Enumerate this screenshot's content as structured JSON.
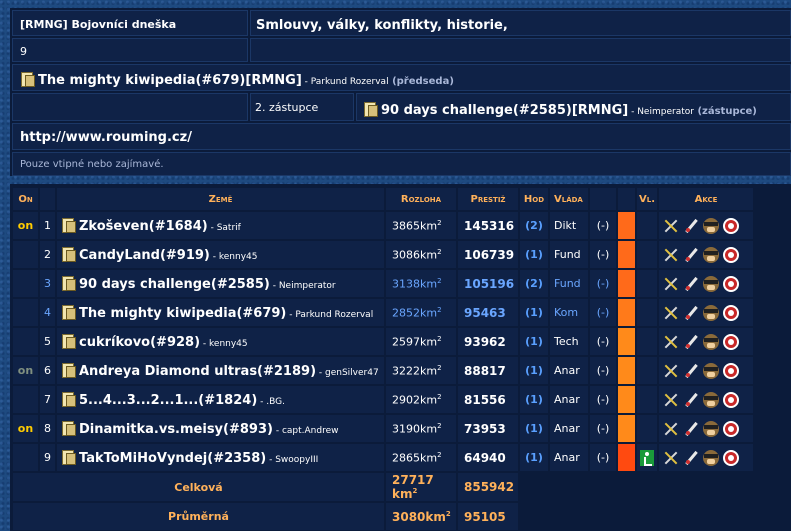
{
  "header": {
    "alliance_tag": "[RMNG] Bojovníci dneška",
    "alliance_desc": "Smlouvy, války, konflikty, historie,",
    "member_count": "9",
    "leader_org": "The mighty kiwipedia(#679)[RMNG]",
    "leader_sep": " - ",
    "leader_name": "Parkund Rozerval",
    "leader_role": "(předseda)",
    "deputy_label": "2. zástupce",
    "deputy_org": "90 days challenge(#2585)[RMNG]",
    "deputy_name": "Neimperator",
    "deputy_role": "(zástupce)",
    "url": "http://www.rouming.cz/",
    "motto": "Pouze vtipné nebo zajímavé."
  },
  "table": {
    "headers": {
      "on": "On",
      "zeme": "Země",
      "rozloha": "Rozloha",
      "prestiz": "Prestiž",
      "hod": "Hod",
      "vlada": "Vláda",
      "vl": "Vl.",
      "akce": "Akce"
    },
    "rows": [
      {
        "on": "on",
        "n": "1",
        "name": "Zkoševen(#1684)",
        "leader": "Satrif",
        "area": "3865km",
        "prestige": "145316",
        "hod": "(2)",
        "vlada": "Dikt",
        "dash": "(-)",
        "bar": "#ff6a1a",
        "blue": false,
        "on_dim": false
      },
      {
        "on": "",
        "n": "2",
        "name": "CandyLand(#919)",
        "leader": "kenny45",
        "area": "3086km",
        "prestige": "106739",
        "hod": "(1)",
        "vlada": "Fund",
        "dash": "(-)",
        "bar": "#ff6a1a",
        "blue": false,
        "on_dim": false
      },
      {
        "on": "",
        "n": "3",
        "name": "90 days challenge(#2585)",
        "leader": "Neimperator",
        "area": "3138km",
        "prestige": "105196",
        "hod": "(2)",
        "vlada": "Fund",
        "dash": "(-)",
        "bar": "#ff6a1a",
        "blue": true,
        "on_dim": false
      },
      {
        "on": "",
        "n": "4",
        "name": "The mighty kiwipedia(#679)",
        "leader": "Parkund Rozerval",
        "area": "2852km",
        "prestige": "95463",
        "hod": "(1)",
        "vlada": "Kom",
        "dash": "(-)",
        "bar": "#ff7a1a",
        "blue": true,
        "on_dim": false
      },
      {
        "on": "",
        "n": "5",
        "name": "cukríkovo(#928)",
        "leader": "kenny45",
        "area": "2597km",
        "prestige": "93962",
        "hod": "(1)",
        "vlada": "Tech",
        "dash": "(-)",
        "bar": "#ff8a1a",
        "blue": false,
        "on_dim": false
      },
      {
        "on": "on",
        "n": "6",
        "name": "Andreya Diamond ultras(#2189)",
        "leader": "genSilver47",
        "area": "3222km",
        "prestige": "88817",
        "hod": "(1)",
        "vlada": "Anar",
        "dash": "(-)",
        "bar": "#ff8a1a",
        "blue": false,
        "on_dim": true
      },
      {
        "on": "",
        "n": "7",
        "name": "5...4...3...2...1...(#1824)",
        "leader": ".BG.",
        "area": "2902km",
        "prestige": "81556",
        "hod": "(1)",
        "vlada": "Anar",
        "dash": "(-)",
        "bar": "#ff8a1a",
        "blue": false,
        "on_dim": false
      },
      {
        "on": "on",
        "n": "8",
        "name": "Dinamitka.vs.meisy(#893)",
        "leader": "capt.Andrew",
        "area": "3190km",
        "prestige": "73953",
        "hod": "(1)",
        "vlada": "Anar",
        "dash": "(-)",
        "bar": "#ff8a1a",
        "blue": false,
        "on_dim": false
      },
      {
        "on": "",
        "n": "9",
        "name": "TakToMiHoVyndej(#2358)",
        "leader": "SwoopyIII",
        "area": "2865km",
        "prestige": "64940",
        "hod": "(1)",
        "vlada": "Anar",
        "dash": "(-)",
        "bar": "#ff4a10",
        "blue": false,
        "on_dim": false,
        "vl_icon": "exit-icon"
      }
    ],
    "totals": {
      "label": "Celková",
      "area": "27717 km",
      "prestige": "855942"
    },
    "average": {
      "label": "Průměrná",
      "area": "3080km",
      "prestige": "95105"
    },
    "area_unit_sup": "2"
  },
  "icons": [
    "swords-icon",
    "pen-icon",
    "spy-icon",
    "bomb-icon"
  ]
}
